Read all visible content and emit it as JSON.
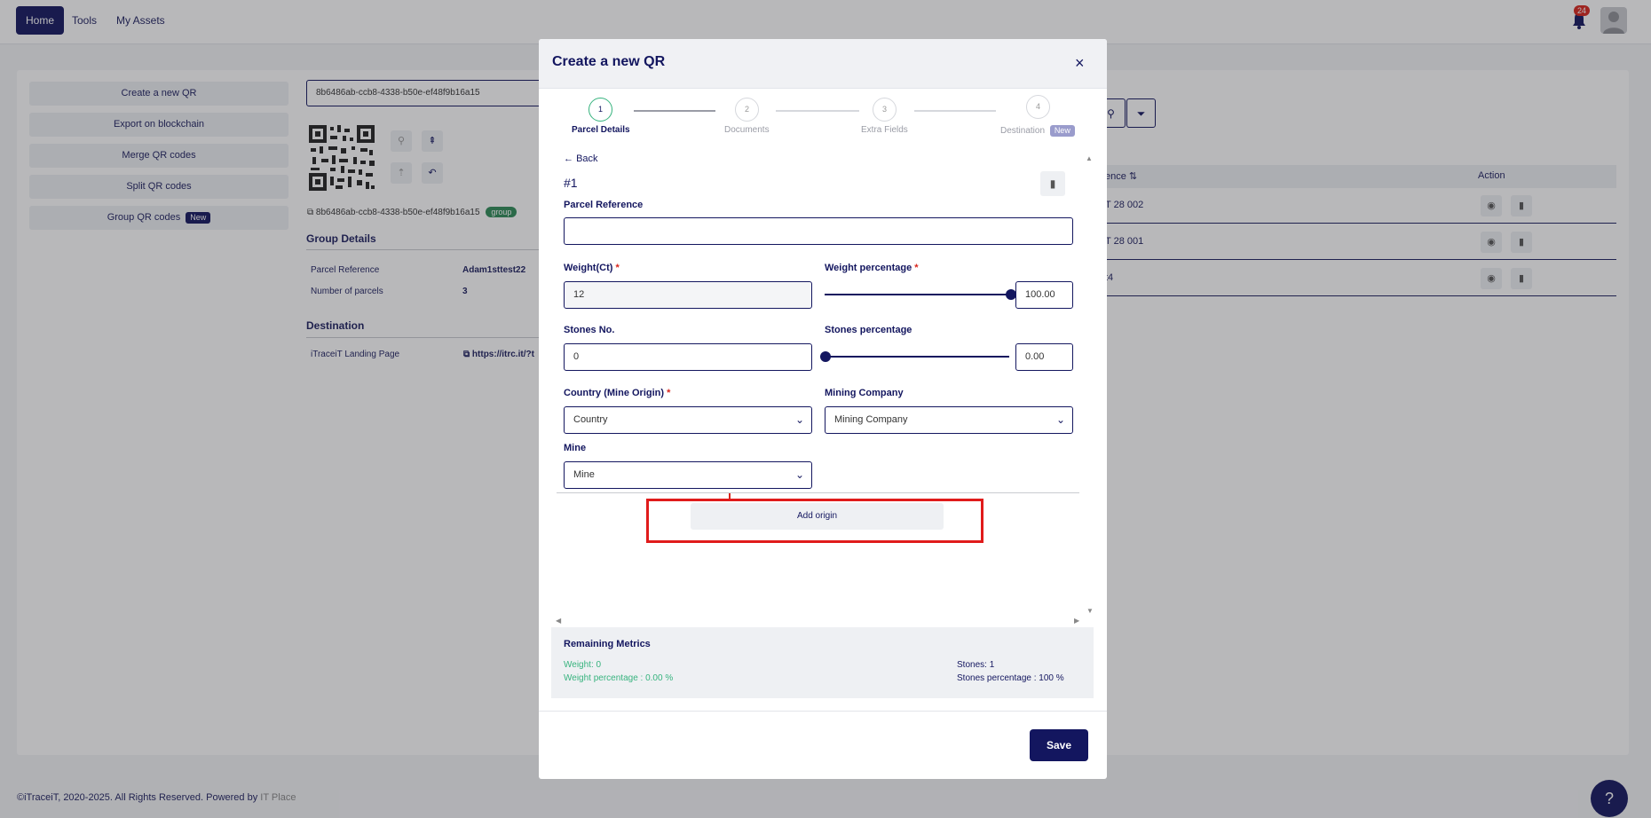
{
  "nav": {
    "home": "Home",
    "tools": "Tools",
    "assets": "My Assets",
    "notification_count": "24"
  },
  "sidebar": {
    "items": [
      {
        "label": "Create a new QR"
      },
      {
        "label": "Export on blockchain"
      },
      {
        "label": "Merge QR codes"
      },
      {
        "label": "Split QR codes"
      },
      {
        "label": "Group QR codes",
        "badge": "New"
      }
    ]
  },
  "detail": {
    "uuid_input": "8b6486ab-ccb8-4338-b50e-ef48f9b16a15",
    "uuid_text": "8b6486ab-ccb8-4338-b50e-ef48f9b16a15",
    "group_badge": "group",
    "group_details_title": "Group Details",
    "parcel_reference_label": "Parcel Reference",
    "parcel_reference_value": "Adam1sttest22",
    "num_parcels_label": "Number of parcels",
    "num_parcels_value": "3",
    "destination_title": "Destination",
    "landing_label": "iTraceiT Landing Page",
    "landing_link": "https://itrc.it/?t"
  },
  "table": {
    "col_reference": "ence",
    "col_action": "Action",
    "rows": [
      {
        "ref": "T 28 002"
      },
      {
        "ref": "T 28 001"
      },
      {
        "ref": "t4"
      }
    ]
  },
  "footer": {
    "copyright": "©iTraceiT, 2020-2025. All Rights Reserved. Powered by",
    "company": "IT Place"
  },
  "modal": {
    "title": "Create a new QR",
    "close": "×",
    "steps": [
      {
        "num": "1",
        "label": "Parcel Details"
      },
      {
        "num": "2",
        "label": "Documents"
      },
      {
        "num": "3",
        "label": "Extra Fields"
      },
      {
        "num": "4",
        "label": "Destination",
        "badge": "New"
      }
    ],
    "back": "Back",
    "parcel_number": "#1",
    "fields": {
      "parcel_reference": {
        "label": "Parcel Reference",
        "value": ""
      },
      "weight": {
        "label": "Weight(Ct)",
        "value": "12"
      },
      "weight_percentage": {
        "label": "Weight percentage",
        "value": "100.00",
        "level": 1.0
      },
      "stones_no": {
        "label": "Stones No.",
        "value": "0"
      },
      "stones_percentage": {
        "label": "Stones percentage",
        "value": "0.00",
        "level": 0.0
      },
      "country": {
        "label": "Country (Mine Origin)",
        "value": "Country"
      },
      "mining_company": {
        "label": "Mining Company",
        "value": "Mining Company"
      },
      "mine": {
        "label": "Mine",
        "value": "Mine"
      }
    },
    "add_origin": "Add origin",
    "metrics": {
      "title": "Remaining Metrics",
      "weight": "Weight: 0",
      "weight_percentage": "Weight percentage : 0.00 %",
      "stones": "Stones: 1",
      "stones_percentage": "Stones percentage : 100 %"
    },
    "save": "Save"
  },
  "colors": {
    "brand": "#13165f",
    "success": "#37b37e",
    "danger": "#d9251c",
    "highlight": "#e01b1b"
  }
}
